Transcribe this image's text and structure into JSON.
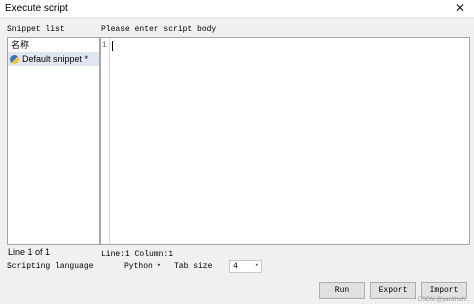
{
  "window": {
    "title": "Execute script",
    "close_glyph": "✕"
  },
  "labels": {
    "snippet_list": "Snippet list",
    "script_body": "Please enter script body"
  },
  "snippet_list": {
    "header": "名称",
    "items": [
      {
        "label": "Default snippet *",
        "icon": "python-icon",
        "selected": true
      }
    ]
  },
  "editor": {
    "line_numbers": [
      "1"
    ],
    "content": ""
  },
  "status": {
    "snippet_position": "Line 1 of 1",
    "cursor": "Line:1  Column:1"
  },
  "options": {
    "language_label": "Scripting language",
    "language_value": "Python",
    "tab_size_label": "Tab size",
    "tab_size_value": "4"
  },
  "buttons": {
    "run": "Run",
    "export": "Export",
    "import": "Import"
  },
  "watermark": "CSDN @yanzhuh..."
}
